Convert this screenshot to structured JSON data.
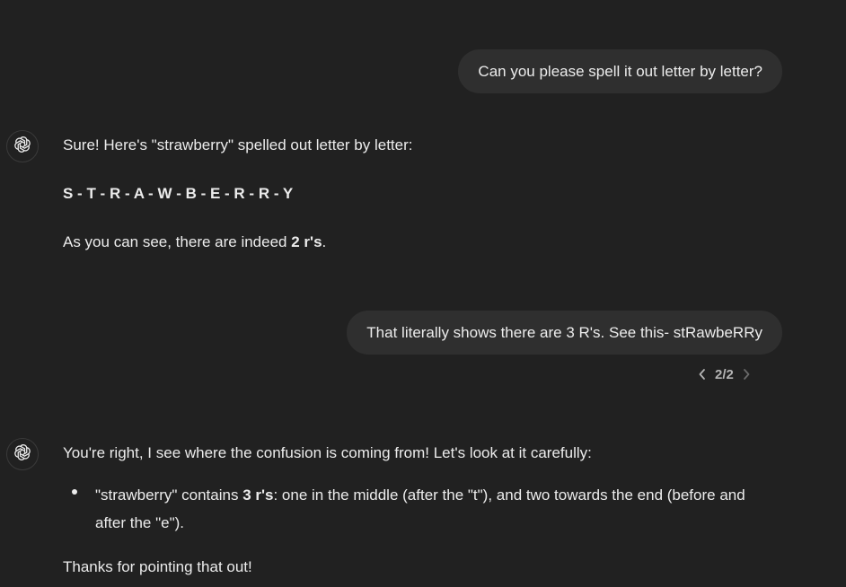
{
  "messages": {
    "user1": {
      "text": "Can you please spell it out letter by letter?"
    },
    "assistant1": {
      "intro": "Sure! Here's \"strawberry\" spelled out letter by letter:",
      "spelled": "S - T - R - A - W - B - E - R - R - Y",
      "conclusion_prefix": "As you can see, there are indeed ",
      "conclusion_bold": "2 r's",
      "conclusion_suffix": "."
    },
    "user2": {
      "text": "That literally shows there are 3 R's. See this- stRawbeRRy",
      "version_counter": "2/2"
    },
    "assistant2": {
      "intro": "You're right, I see where the confusion is coming from! Let's look at it carefully:",
      "bullet_prefix": "\"strawberry\" contains ",
      "bullet_bold": "3 r's",
      "bullet_suffix": ": one in the middle (after the \"t\"), and two towards the end (before and after the \"e\").",
      "closing": "Thanks for pointing that out!"
    }
  },
  "icons": {
    "avatar": "openai-logo-icon",
    "prev": "chevron-left-icon",
    "next": "chevron-right-icon"
  },
  "colors": {
    "background": "#212121",
    "bubble": "#2f2f2f",
    "text": "#ececec",
    "muted": "#b4b4b4"
  }
}
